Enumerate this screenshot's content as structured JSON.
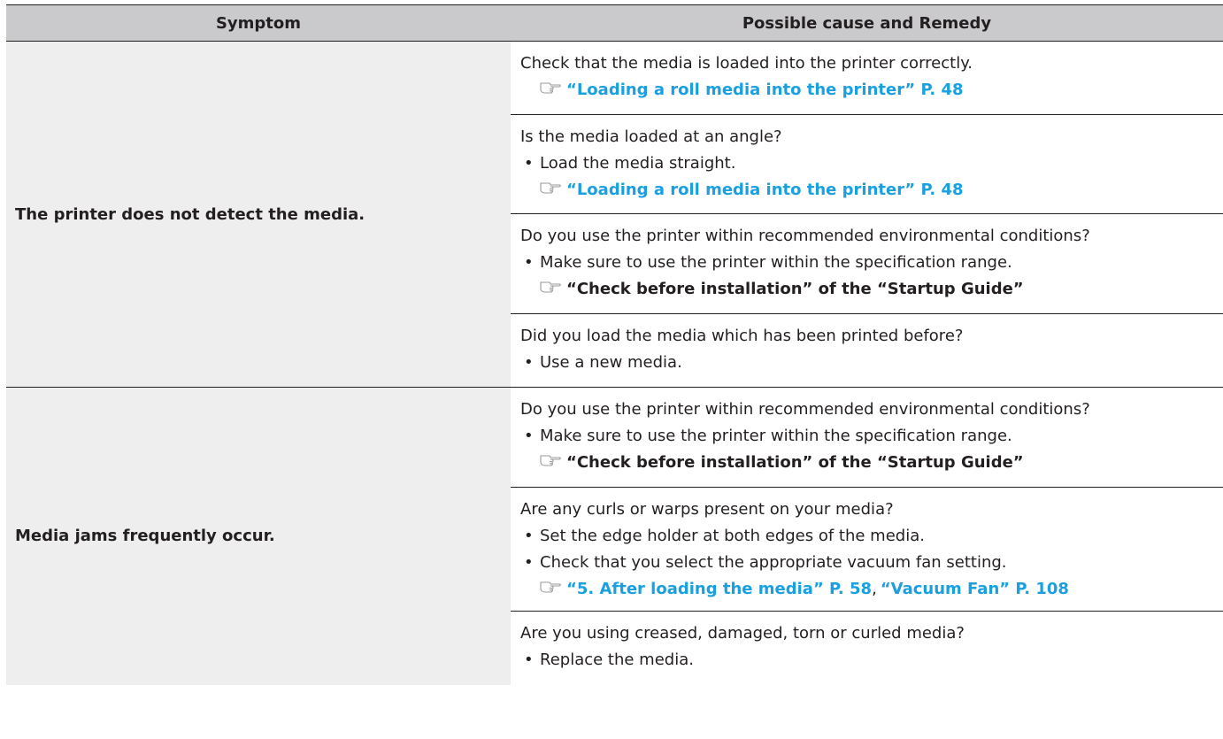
{
  "header": {
    "symptom": "Symptom",
    "remedy": "Possible cause and Remedy"
  },
  "groups": [
    {
      "symptom": "The printer does not detect the media.",
      "rows": [
        {
          "question": "Check that the media is loaded into the printer correctly.",
          "ref": "“Loading a roll media into the printer” P. 48"
        },
        {
          "question": "Is the media loaded at an angle?",
          "bullet": "Load the media straight.",
          "ref": "“Loading a roll media into the printer” P. 48"
        },
        {
          "question": "Do you use the printer within recommended environmental conditions?",
          "bullet": "Make sure to use the printer within the specification range.",
          "ref": "“Check before installation” of the “Startup Guide”"
        },
        {
          "question": "Did you load the media which has been printed before?",
          "bullet": "Use a new media."
        }
      ]
    },
    {
      "symptom": "Media jams frequently occur.",
      "rows": [
        {
          "question": "Do you use the printer within recommended environmental conditions?",
          "bullet": "Make sure to use the printer within the specification range.",
          "ref": "“Check before installation” of the “Startup Guide”"
        },
        {
          "question": "Are any curls or warps present on your media?",
          "bullet": "Set the edge holder at both edges of the media.",
          "bullet2": "Check that you select the appropriate vacuum fan setting.",
          "ref": "“5. After loading the media” P. 58",
          "ref2": "“Vacuum Fan” P. 108"
        },
        {
          "question": "Are you using creased, damaged, torn or curled media?",
          "bullet": "Replace the media."
        }
      ]
    }
  ],
  "bullet_char": "•",
  "ref_separator": ",",
  "icons": {
    "reference": "pointing-hand-reference-icon"
  },
  "colors": {
    "header_bg": "#cacacc",
    "symptom_bg": "#eeeeee",
    "link": "#1aa0e0",
    "text": "#231f20"
  }
}
